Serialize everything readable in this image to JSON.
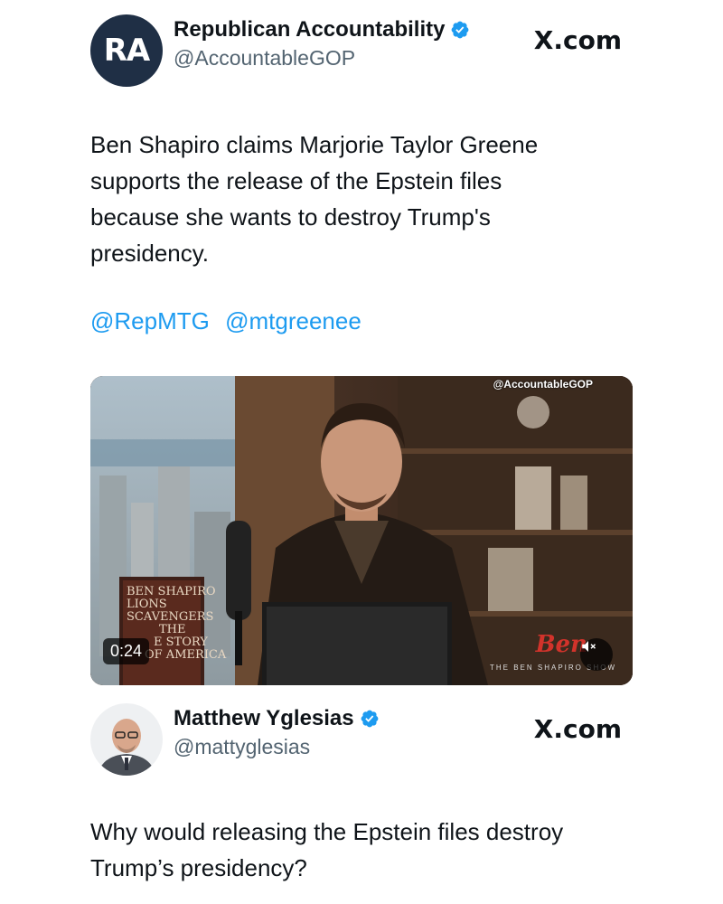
{
  "tweet1": {
    "avatar_initials": "RA",
    "display_name": "Republican Accountability",
    "handle": "@AccountableGOP",
    "source": "X.com",
    "text_lines": [
      "Ben Shapiro claims Marjorie Taylor Greene",
      "supports the release of the Epstein files",
      "because she wants to destroy Trump's",
      "presidency."
    ],
    "mentions": [
      "@RepMTG",
      "@mtgreenee"
    ],
    "video": {
      "watermark": "@AccountableGOP",
      "duration": "0:24",
      "book_lines": [
        "BEN SHAPIRO",
        "LIONS",
        "SCAVENGERS",
        "THE",
        "E STORY",
        "OF AMERICA"
      ],
      "show_logo": "Ben",
      "show_tag": "THE BEN SHAPIRO SHOW"
    }
  },
  "tweet2": {
    "display_name": "Matthew Yglesias",
    "handle": "@mattyglesias",
    "source": "X.com",
    "text_lines": [
      "Why would releasing the Epstein files destroy",
      "Trump’s presidency?"
    ]
  },
  "colors": {
    "verified": "#1d9bf0",
    "mention": "#1d9bf0",
    "handle": "#536471",
    "avatar_bg": "#1f2f45"
  }
}
